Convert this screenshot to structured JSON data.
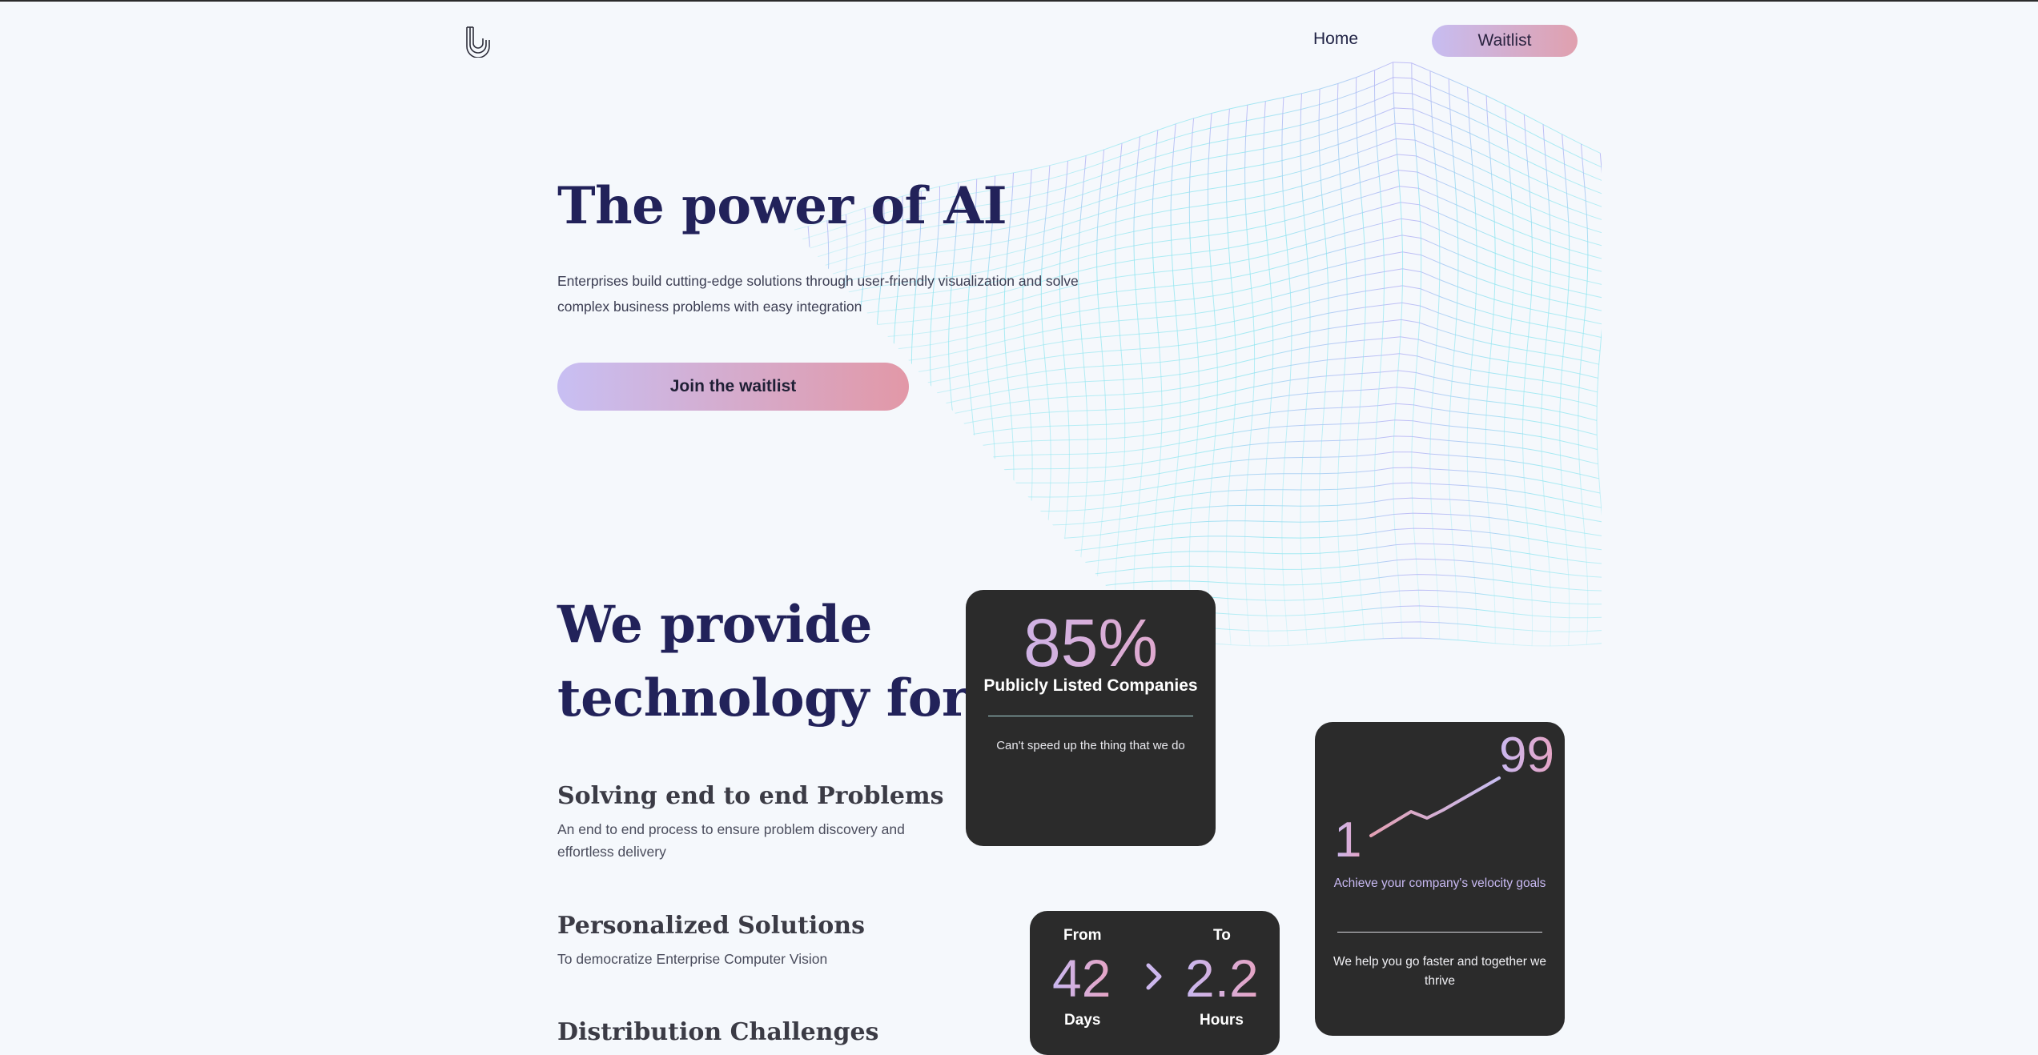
{
  "nav": {
    "home_label": "Home",
    "waitlist_label": "Waitlist"
  },
  "hero": {
    "title": "The power of AI",
    "description": "Enterprises build cutting-edge solutions through user-friendly visualization and solve complex business problems with easy integration",
    "cta_label": "Join the waitlist"
  },
  "provide": {
    "title": "We provide technology for",
    "features": [
      {
        "title": "Solving end to end Problems",
        "description": "An end to end process to ensure problem discovery and effortless delivery"
      },
      {
        "title": "Personalized Solutions",
        "description": "To democratize Enterprise Computer Vision"
      },
      {
        "title": "Distribution Challenges",
        "description": ""
      }
    ]
  },
  "stats": {
    "companies": {
      "value": "85%",
      "label": "Publicly Listed Companies",
      "note": "Can't speed up the thing that we do"
    },
    "velocity": {
      "from": "1",
      "to": "99",
      "caption": "Achieve your company's velocity goals",
      "note": "We help you go faster and together we thrive"
    },
    "time": {
      "from_label": "From",
      "from_value": "42",
      "from_unit": "Days",
      "to_label": "To",
      "to_value": "2.2",
      "to_unit": "Hours"
    }
  },
  "colors": {
    "page_bg": "#f5f8fc",
    "heading": "#22225a",
    "card_bg": "#2b2b2b",
    "gradient_start": "#c7bdf1",
    "gradient_end": "#e0a0ae",
    "mesh": "#7fe3ef"
  },
  "icons": {
    "logo": "stylized-letter-logo",
    "arrow": "chevron-right-icon"
  }
}
